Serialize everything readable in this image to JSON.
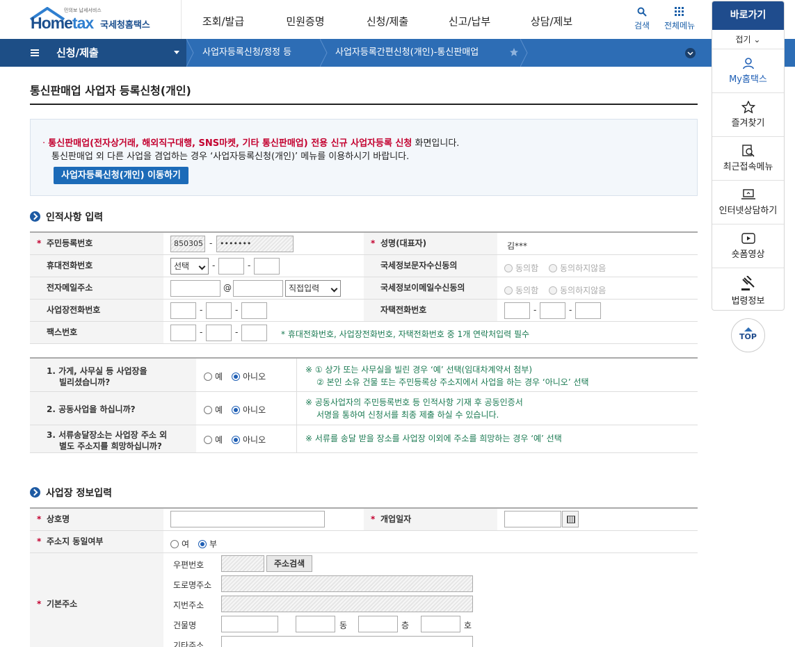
{
  "header": {
    "logo_small": "민의보 납세서비스",
    "logo_home": "Home",
    "logo_tax": "tax",
    "logo_kr": "국세청홈택스",
    "gnb": [
      "조회/발급",
      "민원증명",
      "신청/제출",
      "신고/납부",
      "상담/제보"
    ],
    "search_label": "검색",
    "allmenu_label": "전체메뉴"
  },
  "nav": {
    "menu_label": "신청/제출",
    "crumb1": "사업자등록신청/정정 등",
    "crumb2": "사업자등록간편신청(개인)-통신판매업"
  },
  "side": {
    "title": "바로가기",
    "fold": "접기",
    "items": [
      "My홈택스",
      "즐겨찾기",
      "최근접속메뉴",
      "인터넷상담하기",
      "숏폼영상",
      "법령정보"
    ],
    "top": "TOP"
  },
  "page": {
    "title": "통신판매업 사업자 등록신청(개인)",
    "notice_bullet": "·",
    "notice_red": "통신판매업(전자상거래, 해외직구대행, SNS마켓, 기타 통신판매업) 전용 신규 사업자등록 신청",
    "notice_rest": " 화면입니다.",
    "notice_line2": "통신판매업 외 다른 사업을 겸업하는 경우 ‘사업자등록신청(개인)’ 메뉴를 이용하시기 바랍니다.",
    "notice_button": "사업자등록신청(개인) 이동하기"
  },
  "personal": {
    "section_title": "인적사항 입력",
    "rrn_label": "주민등록번호",
    "rrn_front": "850305",
    "rrn_back": "•••••••",
    "name_label": "성명(대표자)",
    "name_value": "김***",
    "mobile_label": "휴대전화번호",
    "mobile_select": "선택",
    "sms_label": "국세정보문자수신동의",
    "agree": "동의함",
    "disagree": "동의하지않음",
    "email_label": "전자메일주소",
    "at": "@",
    "email_select": "직접입력",
    "email_agree_label": "국세정보이메일수신동의",
    "biz_phone_label": "사업장전화번호",
    "home_phone_label": "자택전화번호",
    "fax_label": "팩스번호",
    "contact_note": "* 휴대전화번호, 사업장전화번호, 자택전화번호 중 1개 연락처입력 필수"
  },
  "questions": [
    {
      "q1": "1. 가게, 사무실 등 사업장을",
      "q2": "빌리셨습니까?",
      "yes": "예",
      "no": "아니오",
      "n1": "※ ① 상가 또는 사무실을 빌린 경우 ‘예’ 선택(임대차계약서 첨부)",
      "n2": "② 본인 소유 건물 또는 주민등록상 주소지에서 사업을 하는 경우 ‘아니오’ 선택"
    },
    {
      "q1": "2. 공동사업을 하십니까?",
      "q2": "",
      "yes": "예",
      "no": "아니오",
      "n1": "※ 공동사업자의 주민등록번호 등 인적사항 기재 후 공동인증서",
      "n2": "서명을 통하여 신청서를 최종 제출 하실 수 있습니다."
    },
    {
      "q1": "3. 서류송달장소는 사업장 주소 외",
      "q2": "별도 주소지를 희망하십니까?",
      "yes": "예",
      "no": "아니오",
      "n1": "※ 서류를 송달 받을 장소를 사업장 이외에 주소를 희망하는 경우 ‘예’ 선택",
      "n2": ""
    }
  ],
  "business": {
    "section_title": "사업장 정보입력",
    "trade_name_label": "상호명",
    "open_date_label": "개업일자",
    "same_addr_label": "주소지 동일여부",
    "yes": "여",
    "no": "부",
    "base_addr_label": "기본주소",
    "zip_label": "우편번호",
    "addr_search_btn": "주소검색",
    "road_label": "도로명주소",
    "lot_label": "지번주소",
    "building_label": "건물명",
    "dong": "동",
    "floor": "층",
    "ho": "호",
    "etc_label": "기타주소"
  }
}
